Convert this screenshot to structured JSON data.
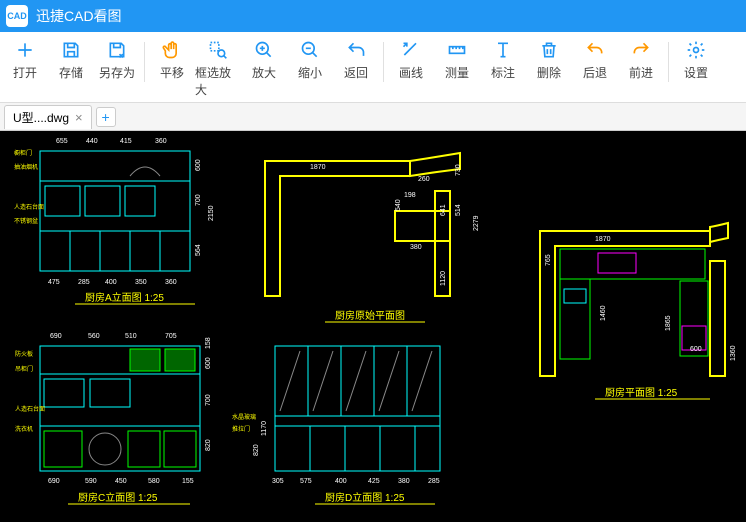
{
  "app": {
    "title": "迅捷CAD看图",
    "logo_text": "CAD"
  },
  "toolbar": [
    {
      "id": "open",
      "label": "打开",
      "group": 0,
      "color": "blue",
      "icon": "plus"
    },
    {
      "id": "save",
      "label": "存储",
      "group": 0,
      "color": "blue",
      "icon": "save"
    },
    {
      "id": "saveas",
      "label": "另存为",
      "group": 0,
      "color": "blue",
      "icon": "saveas"
    },
    {
      "id": "pan",
      "label": "平移",
      "group": 1,
      "color": "orange",
      "icon": "hand"
    },
    {
      "id": "zoomwin",
      "label": "框选放大",
      "group": 1,
      "color": "blue",
      "icon": "zoomwin"
    },
    {
      "id": "zoomin",
      "label": "放大",
      "group": 1,
      "color": "blue",
      "icon": "zoomin"
    },
    {
      "id": "zoomout",
      "label": "缩小",
      "group": 1,
      "color": "blue",
      "icon": "zoomout"
    },
    {
      "id": "back",
      "label": "返回",
      "group": 1,
      "color": "blue",
      "icon": "return"
    },
    {
      "id": "line",
      "label": "画线",
      "group": 2,
      "color": "blue",
      "icon": "line"
    },
    {
      "id": "measure",
      "label": "测量",
      "group": 2,
      "color": "blue",
      "icon": "ruler"
    },
    {
      "id": "annotate",
      "label": "标注",
      "group": 2,
      "color": "blue",
      "icon": "text"
    },
    {
      "id": "delete",
      "label": "删除",
      "group": 2,
      "color": "blue",
      "icon": "trash"
    },
    {
      "id": "undo",
      "label": "后退",
      "group": 2,
      "color": "orange",
      "icon": "undo"
    },
    {
      "id": "redo",
      "label": "前进",
      "group": 2,
      "color": "orange",
      "icon": "redo"
    },
    {
      "id": "settings",
      "label": "设置",
      "group": 3,
      "color": "blue",
      "icon": "gear"
    }
  ],
  "tab": {
    "name": "U型....dwg"
  },
  "drawings": {
    "elevA": {
      "title": "厨房A立面图 1:25",
      "dims_top": [
        "655",
        "440",
        "415",
        "360"
      ],
      "dims_bot": [
        "475",
        "285",
        "400",
        "350",
        "360"
      ],
      "dims_rt": [
        "600",
        "700",
        "2150",
        "564"
      ]
    },
    "plan_raw": {
      "title": "厨房原始平面图",
      "dims": [
        "1870",
        "260",
        "730",
        "540",
        "198",
        "641",
        "514",
        "380",
        "1120",
        "2279"
      ]
    },
    "plan": {
      "title": "厨房平面图 1:25",
      "dims": [
        "1870",
        "765",
        "1460",
        "1865",
        "600",
        "1360"
      ]
    },
    "elevC": {
      "title": "厨房C立面图 1:25",
      "dims_top": [
        "690",
        "560",
        "510",
        "705"
      ],
      "dims_bot": [
        "690",
        "590",
        "450",
        "580",
        "155"
      ],
      "dims_rt": [
        "820",
        "700",
        "600",
        "158"
      ]
    },
    "elevD": {
      "title": "厨房D立面图 1:25",
      "dims": [
        "305",
        "575",
        "400",
        "425",
        "380",
        "285",
        "820",
        "1170"
      ]
    }
  }
}
